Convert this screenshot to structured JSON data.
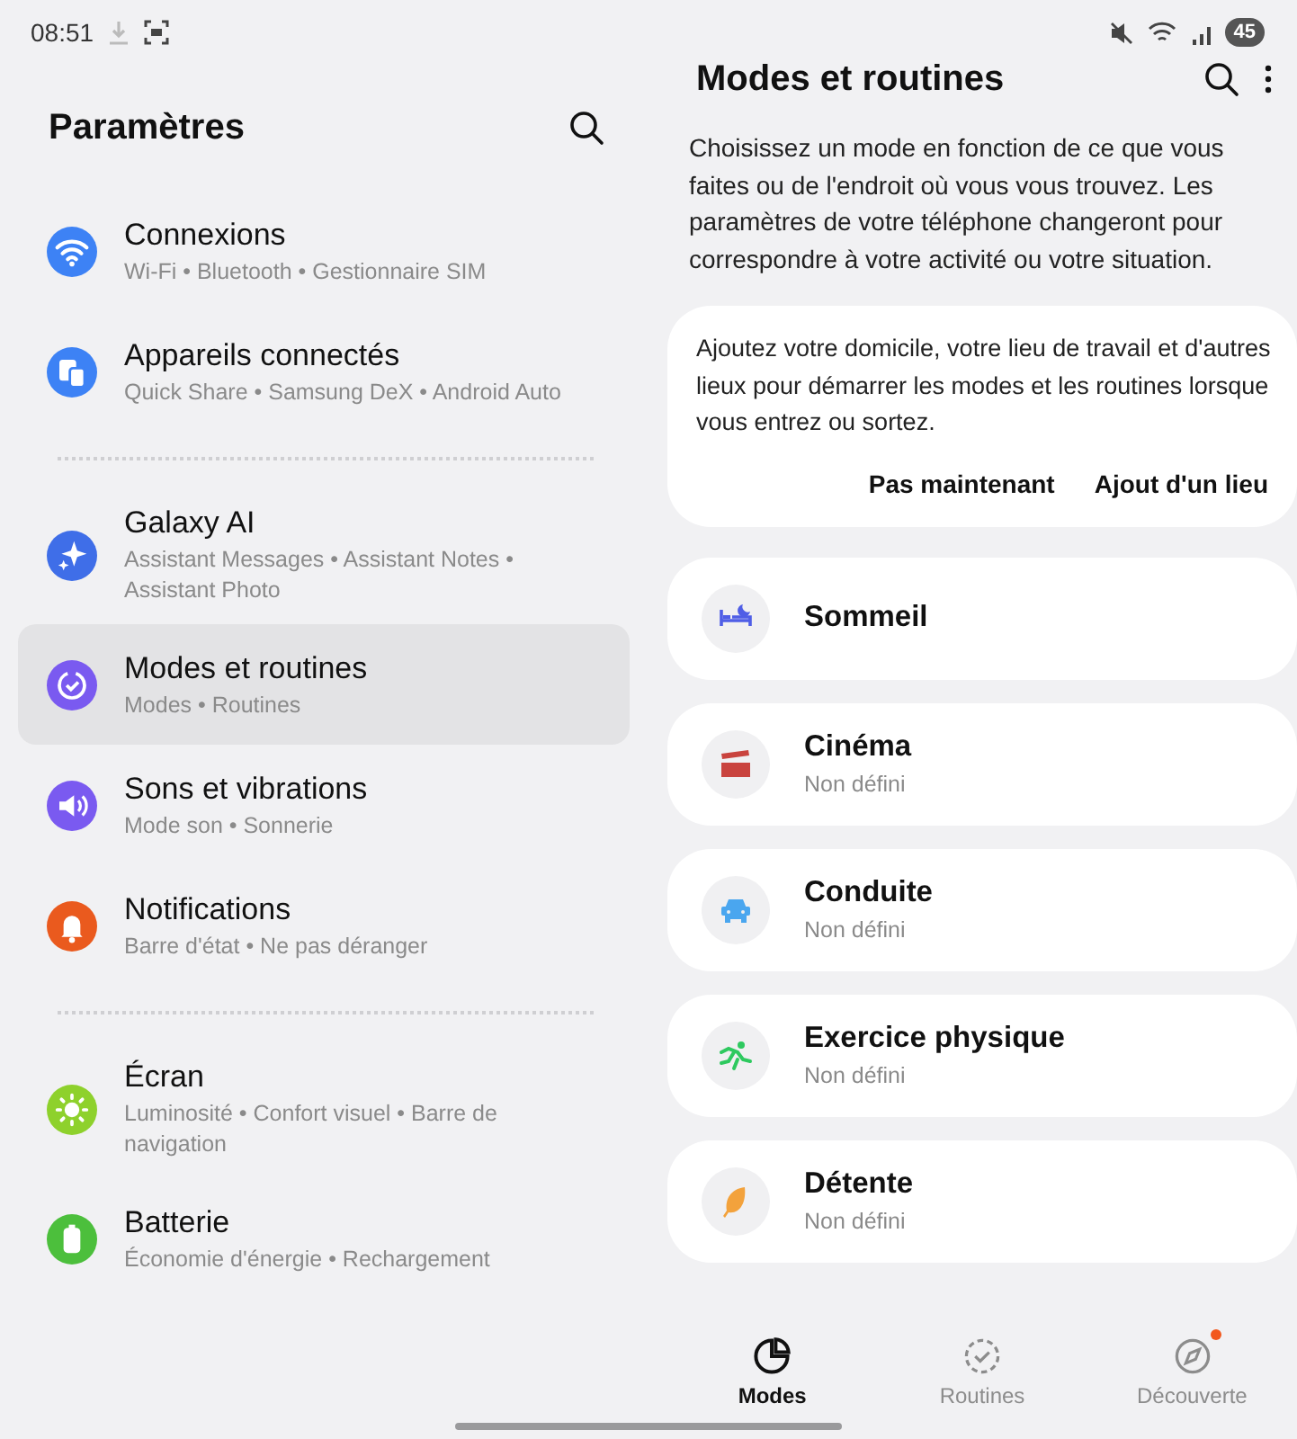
{
  "status_bar": {
    "time": "08:51",
    "battery": "45"
  },
  "settings": {
    "title": "Paramètres",
    "groups": [
      {
        "items": [
          {
            "title": "Connexions",
            "subtitle": "Wi-Fi • Bluetooth • Gestionnaire SIM",
            "color": "#3d82f5",
            "selected": false
          },
          {
            "title": "Appareils connectés",
            "subtitle": "Quick Share • Samsung DeX • Android Auto",
            "color": "#3d82f5",
            "selected": false
          }
        ]
      },
      {
        "items": [
          {
            "title": "Galaxy AI",
            "subtitle": "Assistant Messages • Assistant Notes • Assistant Photo",
            "color": "#3f6ee8",
            "selected": false
          },
          {
            "title": "Modes et routines",
            "subtitle": "Modes • Routines",
            "color": "#7a5af0",
            "selected": true
          },
          {
            "title": "Sons et vibrations",
            "subtitle": "Mode son • Sonnerie",
            "color": "#7a5af0",
            "selected": false
          },
          {
            "title": "Notifications",
            "subtitle": "Barre d'état • Ne pas déranger",
            "color": "#ea5a1e",
            "selected": false
          }
        ]
      },
      {
        "items": [
          {
            "title": "Écran",
            "subtitle": "Luminosité • Confort visuel • Barre de navigation",
            "color": "#8ed12c",
            "selected": false
          },
          {
            "title": "Batterie",
            "subtitle": "Économie d'énergie • Rechargement",
            "color": "#4cbf3c",
            "selected": false
          }
        ]
      }
    ]
  },
  "modes_panel": {
    "title": "Modes et routines",
    "description": "Choisissez un mode en fonction de ce que vous faites ou de l'endroit où vous vous trouvez. Les paramètres de votre téléphone changeront pour correspondre à votre activité ou votre situation.",
    "location_card": {
      "text": "Ajoutez votre domicile, votre lieu de travail et d'autres lieux pour démarrer les modes et les routines lorsque vous entrez ou sortez.",
      "buttons": [
        "Pas maintenant",
        "Ajout d'un lieu"
      ]
    },
    "modes": [
      {
        "title": "Sommeil",
        "color": "#4f5ee6"
      },
      {
        "title": "Cinéma",
        "subtitle": "Non défini",
        "color": "#c9433e"
      },
      {
        "title": "Conduite",
        "subtitle": "Non défini",
        "color": "#4aa6ef"
      },
      {
        "title": "Exercice physique",
        "subtitle": "Non défini",
        "color": "#2ec95f"
      },
      {
        "title": "Détente",
        "subtitle": "Non défini",
        "color": "#f3a23c"
      }
    ],
    "tabs": [
      {
        "label": "Modes",
        "selected": true,
        "notification_dot": false
      },
      {
        "label": "Routines",
        "selected": false,
        "notification_dot": false
      },
      {
        "label": "Découverte",
        "selected": false,
        "notification_dot": true
      }
    ]
  }
}
